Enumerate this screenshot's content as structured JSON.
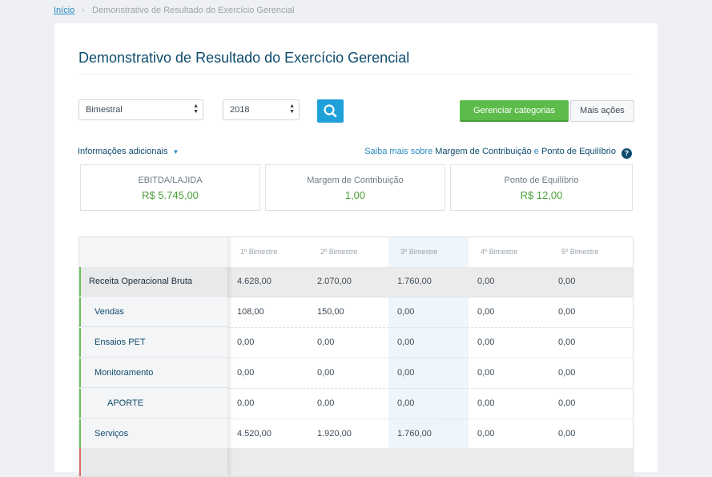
{
  "breadcrumb": {
    "home": "Início",
    "sep": "›",
    "current": "Demonstrativo de Resultado do Exercício Gerencial"
  },
  "page": {
    "title": "Demonstrativo de Resultado do Exercício Gerencial"
  },
  "filters": {
    "period": "Bimestral",
    "year": "2018",
    "search_icon": "search-icon",
    "manage_label": "Gerenciar categorias",
    "more_label": "Mais ações"
  },
  "info": {
    "toggle_label": "Informações adicionais",
    "learn_prefix": "Saiba mais sobre",
    "learn_link1": "Margem de Contribuição",
    "learn_and": "e",
    "learn_link2": "Ponto de Equilíbrio",
    "help": "?"
  },
  "kpis": [
    {
      "label": "EBITDA/LAJIDA",
      "value": "R$ 5.745,00"
    },
    {
      "label": "Margem de Contribuição",
      "value": "1,00"
    },
    {
      "label": "Ponto de Equilíbrio",
      "value": "R$ 12,00"
    }
  ],
  "table": {
    "columns": [
      "1º Bimestre",
      "2º Bimestre",
      "3º Bimestre",
      "4º Bimestre",
      "5º Bimestre"
    ],
    "rows": [
      {
        "label": "Receita Operacional Bruta",
        "values": [
          "4.628,00",
          "2.070,00",
          "1.760,00",
          "0,00",
          "0,00"
        ]
      },
      {
        "label": "Vendas",
        "values": [
          "108,00",
          "150,00",
          "0,00",
          "0,00",
          "0,00"
        ]
      },
      {
        "label": "Ensaios PET",
        "values": [
          "0,00",
          "0,00",
          "0,00",
          "0,00",
          "0,00"
        ]
      },
      {
        "label": "Monitoramento",
        "values": [
          "0,00",
          "0,00",
          "0,00",
          "0,00",
          "0,00"
        ]
      },
      {
        "label": "APORTE",
        "values": [
          "0,00",
          "0,00",
          "0,00",
          "0,00",
          "0,00"
        ]
      },
      {
        "label": "Serviços",
        "values": [
          "4.520,00",
          "1.920,00",
          "1.760,00",
          "0,00",
          "0,00"
        ]
      }
    ]
  },
  "colors": {
    "accent": "#1ea0d9",
    "green": "#5dbb4a",
    "title": "#0e4c6d",
    "value_green": "#4ca23a"
  }
}
